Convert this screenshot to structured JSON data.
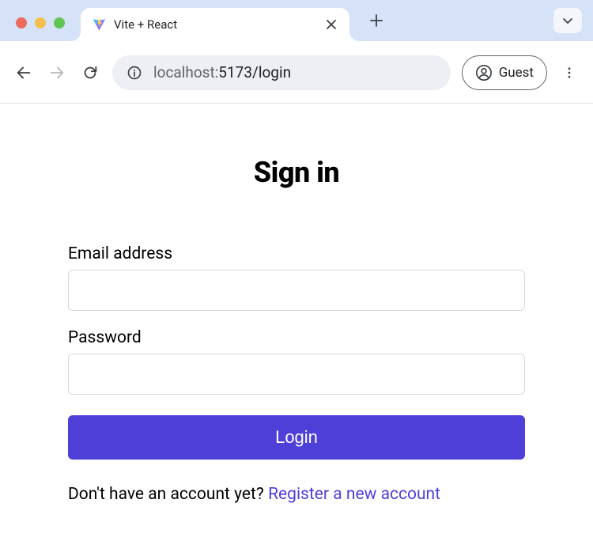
{
  "browser": {
    "tab_title": "Vite + React",
    "url_display_prefix": "localhost:",
    "url_display_rest": "5173/login",
    "profile_label": "Guest"
  },
  "page": {
    "title": "Sign in",
    "email_label": "Email address",
    "email_value": "",
    "password_label": "Password",
    "password_value": "",
    "login_button": "Login",
    "register_prompt": "Don't have an account yet? ",
    "register_link": "Register a new account"
  },
  "colors": {
    "primary": "#4e3fd9"
  }
}
